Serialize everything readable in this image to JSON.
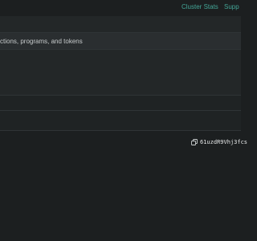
{
  "nav": {
    "cluster_stats": "Cluster Stats",
    "support": "Supp"
  },
  "search": {
    "placeholder": "ctions, programs, and tokens"
  },
  "account": {
    "address_prefix": "61uzdR9Vhj3fcs"
  },
  "colors": {
    "background": "#1c1f20",
    "accent": "#43a596",
    "search_bg": "#2a2e30",
    "band": "#232728"
  }
}
